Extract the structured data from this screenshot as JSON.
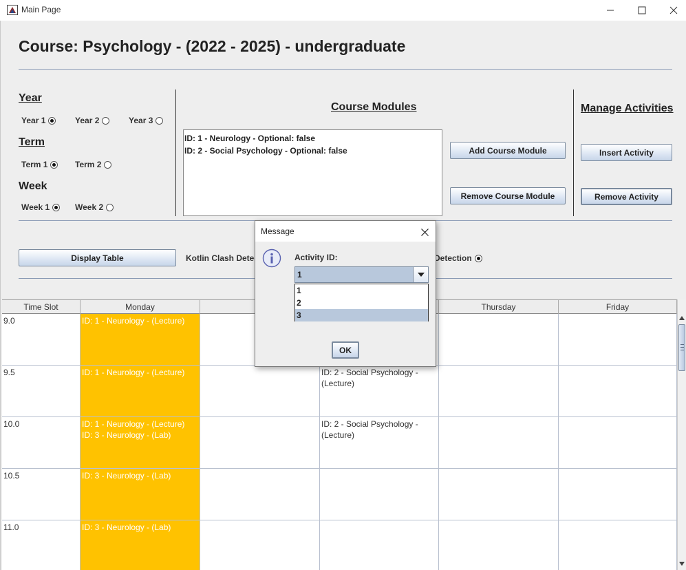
{
  "window": {
    "title": "Main Page"
  },
  "course_title": "Course: Psychology - (2022 - 2025) - undergraduate",
  "year": {
    "heading": "Year",
    "options": [
      "Year 1",
      "Year 2",
      "Year 3"
    ],
    "selected": "Year 1"
  },
  "term": {
    "heading": "Term",
    "options": [
      "Term 1",
      "Term 2"
    ],
    "selected": "Term 1"
  },
  "week": {
    "heading": "Week",
    "options": [
      "Week 1",
      "Week 2"
    ],
    "selected": "Week 1"
  },
  "course_modules": {
    "heading": "Course Modules",
    "items": [
      "ID: 1 - Neurology - Optional: false",
      "ID: 2 - Social Psychology - Optional: false"
    ],
    "add_label": "Add Course Module",
    "remove_label": "Remove Course Module"
  },
  "manage_activities": {
    "heading": "Manage Activities",
    "insert_label": "Insert Activity",
    "remove_label": "Remove Activity"
  },
  "controls": {
    "display_table_label": "Display Table",
    "kotlin_clash_label": "Kotlin Clash Detec",
    "detection_label": "Detection"
  },
  "timetable": {
    "columns": [
      "Time Slot",
      "Monday",
      "Tu",
      "",
      "Thursday",
      "Friday"
    ],
    "rows": [
      {
        "slot": "9.0",
        "monday": [
          "ID: 1 - Neurology - (Lecture)"
        ],
        "wednesday": []
      },
      {
        "slot": "9.5",
        "monday": [
          "ID: 1 - Neurology - (Lecture)"
        ],
        "wednesday": [
          "ID: 2 - Social Psychology -",
          "(Lecture)"
        ]
      },
      {
        "slot": "10.0",
        "monday": [
          "ID: 1 - Neurology - (Lecture)",
          "ID: 3 - Neurology - (Lab)"
        ],
        "wednesday": [
          "ID: 2 - Social Psychology -",
          "(Lecture)"
        ]
      },
      {
        "slot": "10.5",
        "monday": [
          "ID: 3 - Neurology - (Lab)"
        ],
        "wednesday": []
      },
      {
        "slot": "11.0",
        "monday": [
          "ID: 3 - Neurology - (Lab)"
        ],
        "wednesday": []
      }
    ],
    "highlight_color": "#ffc200"
  },
  "dialog": {
    "title": "Message",
    "label": "Activity ID:",
    "selected": "1",
    "options": [
      "1",
      "2",
      "3"
    ],
    "highlighted_option": "3",
    "ok_label": "OK"
  }
}
